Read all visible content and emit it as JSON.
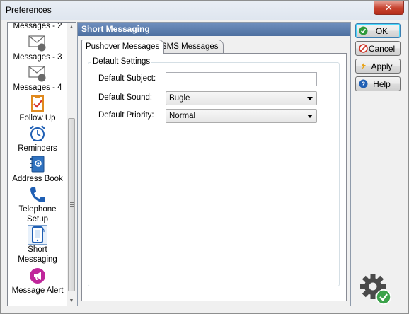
{
  "window": {
    "title": "Preferences",
    "close_label": "✕"
  },
  "sidebar": {
    "items": [
      {
        "label": "Messages - 2",
        "icon": "envelope-icon"
      },
      {
        "label": "Messages - 3",
        "icon": "envelope-3-icon",
        "badge": "3"
      },
      {
        "label": "Messages - 4",
        "icon": "envelope-4-icon",
        "badge": "4"
      },
      {
        "label": "Follow Up",
        "icon": "clipboard-check-icon"
      },
      {
        "label": "Reminders",
        "icon": "alarm-clock-icon"
      },
      {
        "label": "Address Book",
        "icon": "address-book-icon"
      },
      {
        "label": "Telephone Setup",
        "icon": "telephone-icon"
      },
      {
        "label": "Short Messaging",
        "icon": "mobile-phone-icon",
        "selected": true
      },
      {
        "label": "Message Alert",
        "icon": "megaphone-icon"
      }
    ]
  },
  "panel": {
    "header": "Short Messaging",
    "tabs": [
      {
        "label": "Pushover Messages",
        "active": true
      },
      {
        "label": "SMS Messages",
        "active": false
      }
    ],
    "group_title": "Default Settings",
    "fields": {
      "subject": {
        "label": "Default Subject:",
        "value": ""
      },
      "sound": {
        "label": "Default Sound:",
        "value": "Bugle"
      },
      "priority": {
        "label": "Default Priority:",
        "value": "Normal"
      }
    }
  },
  "buttons": {
    "ok": "OK",
    "cancel": "Cancel",
    "apply": "Apply",
    "help": "Help"
  },
  "colors": {
    "header_bg": "#5a7bab",
    "close_bg": "#c7432f",
    "ok_icon": "#2e9a3a",
    "cancel_icon": "#d03a2c",
    "help_icon": "#1f5fb4"
  }
}
